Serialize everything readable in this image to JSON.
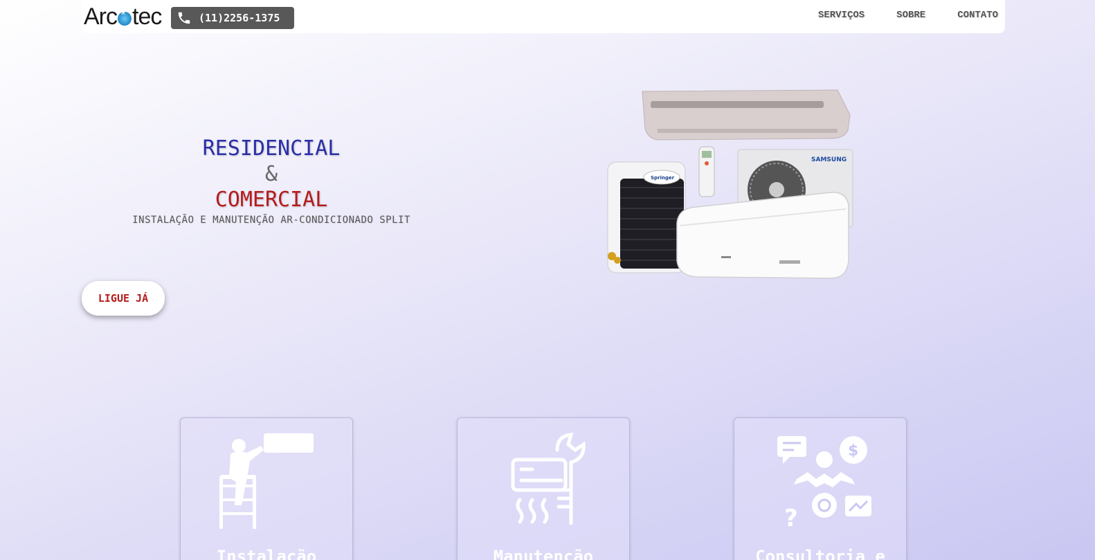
{
  "header": {
    "logo": {
      "part1": "Arc",
      "part2": "tec"
    },
    "phone": "(11)2256-1375",
    "nav": [
      "SERVIÇOS",
      "SOBRE",
      "CONTATO"
    ]
  },
  "hero": {
    "line1": "RESIDENCIAL",
    "amp": "&",
    "line2": "COMERCIAL",
    "subtitle": "INSTALAÇÃO E MANUTENÇÃO AR-CONDICIONADO SPLIT",
    "cta": "LIGUE JÁ",
    "image_labels": {
      "brand1": "SAMSUNG",
      "brand2": "Springer"
    }
  },
  "services": [
    {
      "title": "Instalação",
      "icon": "installer-ladder-icon"
    },
    {
      "title": "Manutenção",
      "icon": "ac-wrench-icon"
    },
    {
      "title": "Consultoria e",
      "icon": "consultant-icon"
    }
  ],
  "colors": {
    "blue": "#2a2fa8",
    "red": "#b51c1c",
    "gray": "#585858"
  }
}
